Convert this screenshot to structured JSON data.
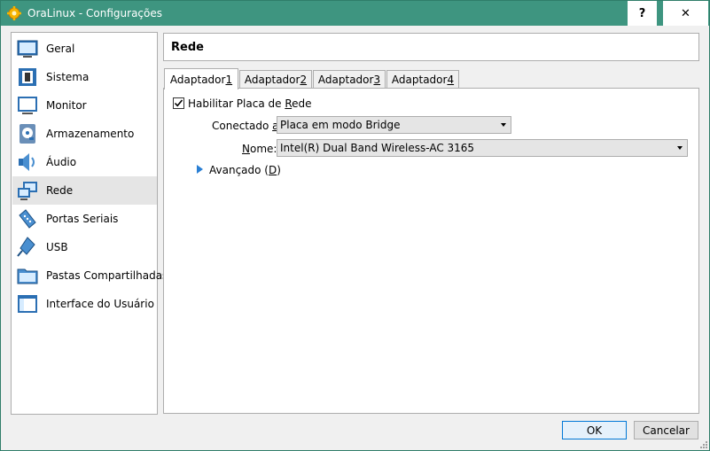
{
  "window": {
    "title": "OraLinux - Configurações",
    "help_symbol": "?",
    "close_symbol": "✕"
  },
  "sidebar": {
    "items": [
      {
        "label": "Geral",
        "icon": "general-icon"
      },
      {
        "label": "Sistema",
        "icon": "system-chip-icon"
      },
      {
        "label": "Monitor",
        "icon": "monitor-icon"
      },
      {
        "label": "Armazenamento",
        "icon": "storage-disk-icon"
      },
      {
        "label": "Áudio",
        "icon": "speaker-icon"
      },
      {
        "label": "Rede",
        "icon": "network-icon",
        "selected": true
      },
      {
        "label": "Portas Seriais",
        "icon": "serial-port-icon"
      },
      {
        "label": "USB",
        "icon": "usb-icon"
      },
      {
        "label": "Pastas Compartilhadas",
        "icon": "shared-folder-icon"
      },
      {
        "label": "Interface do Usuário",
        "icon": "user-interface-icon"
      }
    ]
  },
  "header": {
    "title": "Rede"
  },
  "tabs": [
    {
      "label": "Adaptador ",
      "num": "1",
      "active": true
    },
    {
      "label": "Adaptador ",
      "num": "2"
    },
    {
      "label": "Adaptador ",
      "num": "3"
    },
    {
      "label": "Adaptador ",
      "num": "4"
    }
  ],
  "panel": {
    "enable_pre": "Habilitar Placa de ",
    "enable_u": "R",
    "enable_post": "ede",
    "enable_checked": true,
    "attached_pre": "Conectado ",
    "attached_u": "a",
    "attached_post": ":",
    "attached_value": "Placa em modo Bridge",
    "name_u": "N",
    "name_post": "ome:",
    "name_value": "Intel(R) Dual Band Wireless-AC 3165",
    "advanced_pre": "Avançado (",
    "advanced_u": "D",
    "advanced_post": ")"
  },
  "buttons": {
    "ok": "OK",
    "cancel": "Cancelar"
  },
  "colors": {
    "titlebar": "#3e9580",
    "selection": "#e5e5e5",
    "accent": "#2a7fd4"
  }
}
